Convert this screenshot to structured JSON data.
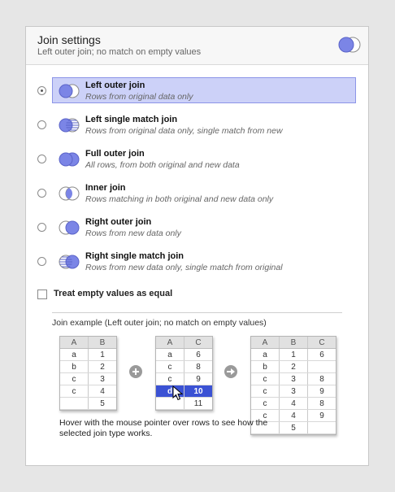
{
  "header": {
    "title": "Join settings",
    "subtitle": "Left outer join; no match on empty values",
    "icon": "left-outer-join-icon"
  },
  "join_options": [
    {
      "label": "Left outer join",
      "description": "Rows from original data only",
      "icon": "left-outer-join-icon",
      "selected": true
    },
    {
      "label": "Left single match join",
      "description": "Rows from original data only, single match from new",
      "icon": "left-single-match-join-icon",
      "selected": false
    },
    {
      "label": "Full outer join",
      "description": "All rows, from both original and new data",
      "icon": "full-outer-join-icon",
      "selected": false
    },
    {
      "label": "Inner join",
      "description": "Rows matching in both original and new data only",
      "icon": "inner-join-icon",
      "selected": false
    },
    {
      "label": "Right outer join",
      "description": "Rows from new data only",
      "icon": "right-outer-join-icon",
      "selected": false
    },
    {
      "label": "Right single match join",
      "description": "Rows from new data only, single match from original",
      "icon": "right-single-match-join-icon",
      "selected": false
    }
  ],
  "empty_values_checkbox": {
    "label": "Treat empty values as equal",
    "checked": false
  },
  "example": {
    "title": "Join example (Left outer join; no match on empty values)",
    "table_original": {
      "headers": [
        "A",
        "B"
      ],
      "rows": [
        [
          "a",
          "1"
        ],
        [
          "b",
          "2"
        ],
        [
          "c",
          "3"
        ],
        [
          "c",
          "4"
        ],
        [
          "",
          "5"
        ]
      ]
    },
    "table_new": {
      "headers": [
        "A",
        "C"
      ],
      "rows": [
        [
          "a",
          "6"
        ],
        [
          "c",
          "8"
        ],
        [
          "c",
          "9"
        ],
        [
          "d",
          "10"
        ],
        [
          "",
          "11"
        ]
      ],
      "highlighted_row": 3
    },
    "table_result": {
      "headers": [
        "A",
        "B",
        "C"
      ],
      "rows": [
        [
          "a",
          "1",
          "6"
        ],
        [
          "b",
          "2",
          ""
        ],
        [
          "c",
          "3",
          "8"
        ],
        [
          "c",
          "3",
          "9"
        ],
        [
          "c",
          "4",
          "8"
        ],
        [
          "c",
          "4",
          "9"
        ],
        [
          "",
          "5",
          ""
        ]
      ]
    },
    "plus_icon": "plus-icon",
    "arrow_icon": "arrow-right-icon",
    "hint": "Hover with the mouse pointer over rows to see how the selected join type works."
  },
  "colors": {
    "venn_fill": "#7b85e6",
    "venn_stroke": "#5a63c8",
    "selected_bg": "#ccd1f8",
    "selected_border": "#8c95e8",
    "highlight_row": "#3b52d4"
  }
}
